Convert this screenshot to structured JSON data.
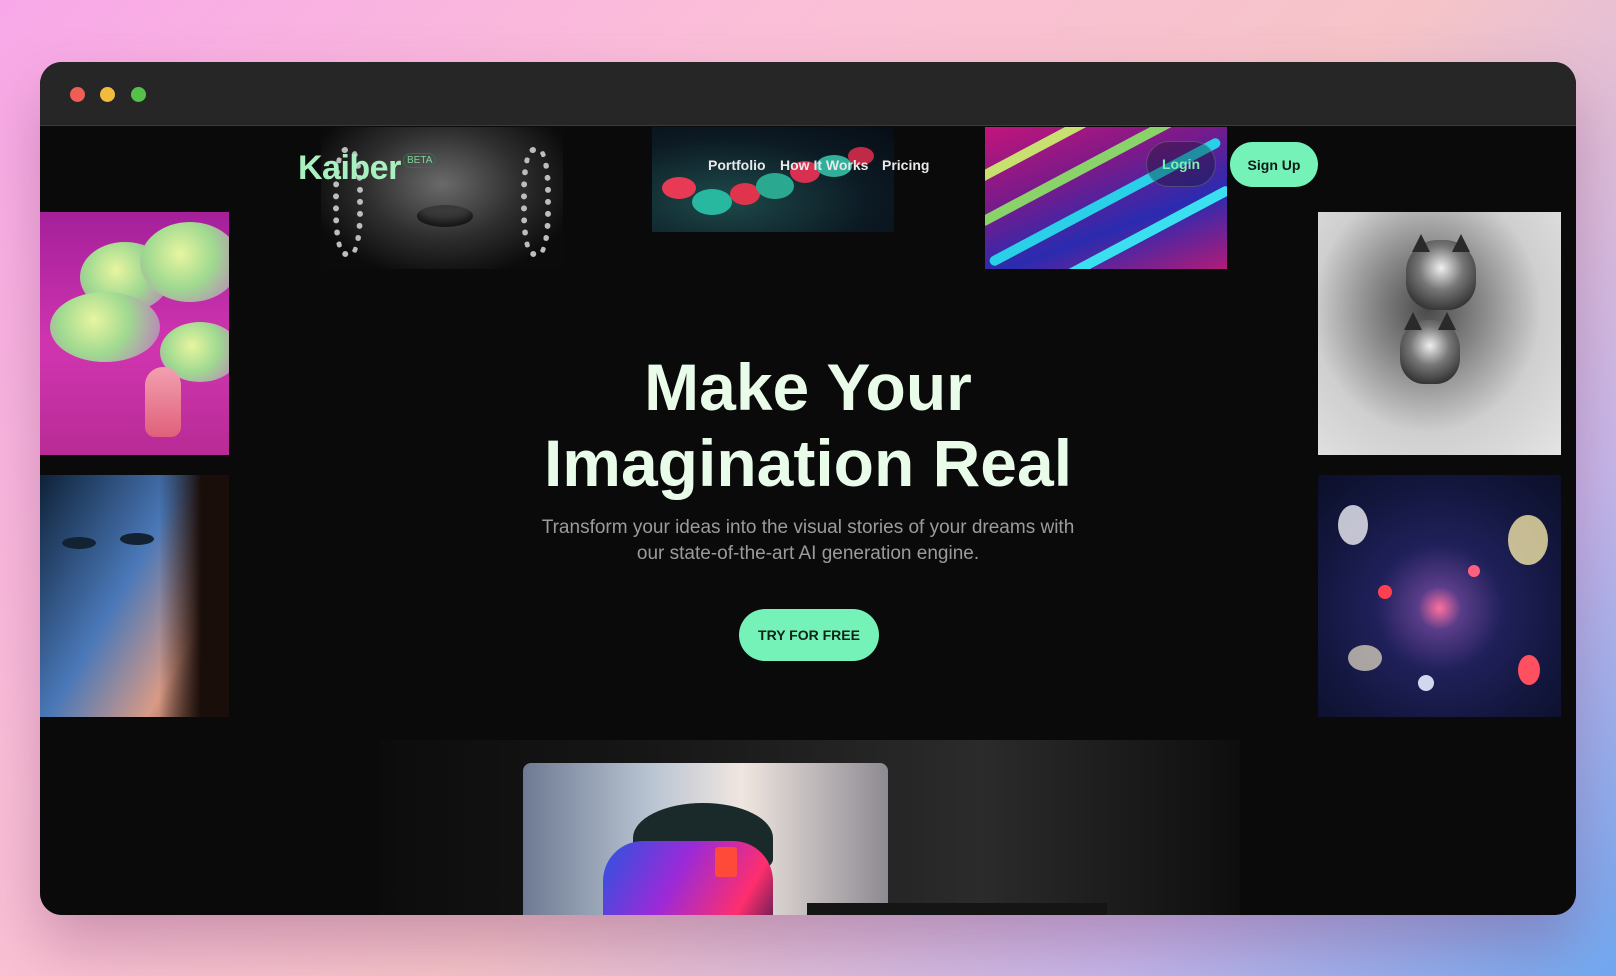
{
  "window": {
    "controls": [
      "close",
      "minimize",
      "maximize"
    ]
  },
  "nav": {
    "logo": "Kaiber",
    "badge": "BETA",
    "links": [
      "Portfolio",
      "How It Works",
      "Pricing"
    ],
    "login": "Login",
    "signup": "Sign Up"
  },
  "hero": {
    "title_line1": "Make Your",
    "title_line2": "Imagination Real",
    "subtitle_line1": "Transform your ideas into the visual stories of your dreams with",
    "subtitle_line2": "our state-of-the-art AI generation engine.",
    "cta": "TRY FOR FREE"
  },
  "colors": {
    "accent": "#74f2b8",
    "title": "#e9fbe9",
    "page_bg": "#0a0a0a",
    "titlebar": "#262626"
  },
  "gallery": [
    "portrait-woman-image",
    "glowing-blobs-image",
    "neon-waves-image",
    "cloud-astronaut-image",
    "woman-face-image",
    "foxes-image",
    "particle-burst-image"
  ]
}
